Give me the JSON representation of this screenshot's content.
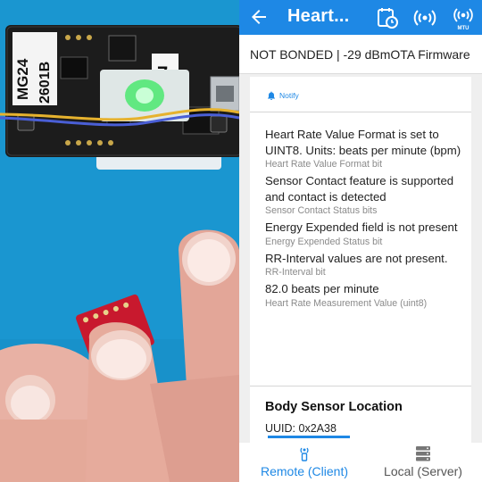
{
  "photo": {
    "board_label_line1": "MG24",
    "board_label_line2": "2601B",
    "board_digit": "7",
    "colors": {
      "background": "#1a96d0",
      "board": "#1c1c1c",
      "led": "#4be86e",
      "sensor_board": "#c8192e"
    }
  },
  "app": {
    "title": "Heart...",
    "back_icon": "arrow-left-icon",
    "actions": [
      {
        "name": "log-icon"
      },
      {
        "name": "broadcast-icon"
      },
      {
        "name": "mtu-icon",
        "caption": "MTU"
      }
    ],
    "status_line": "NOT BONDED | -29 dBmOTA Firmware",
    "notify_label": "Notify",
    "fields": [
      {
        "value": "Heart Rate Value Format is set to UINT8. Units: beats per minute (bpm)",
        "label": "Heart Rate Value Format bit"
      },
      {
        "value": "Sensor Contact feature is supported and contact is detected",
        "label": "Sensor Contact Status bits"
      },
      {
        "value": "Energy Expended field is not present",
        "label": "Energy Expended Status bit"
      },
      {
        "value": "RR-Interval values are not present.",
        "label": "RR-Interval bit"
      },
      {
        "value": "82.0 beats per minute",
        "label": "Heart Rate Measurement Value (uint8)"
      }
    ],
    "next_characteristic": {
      "title": "Body Sensor Location",
      "uuid": "UUID: 0x2A38"
    },
    "bottom_nav": [
      {
        "label": "Remote (Client)",
        "icon": "remote-client-icon",
        "active": true
      },
      {
        "label": "Local (Server)",
        "icon": "local-server-icon",
        "active": false
      }
    ],
    "colors": {
      "primary": "#1e88e5",
      "background": "#efefef"
    }
  }
}
